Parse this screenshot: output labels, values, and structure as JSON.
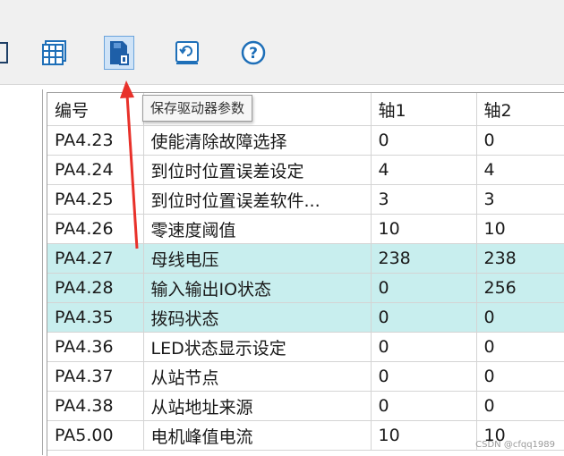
{
  "toolbar": {
    "buttons": [
      {
        "icon": "window-icon"
      },
      {
        "icon": "grid-table-icon"
      },
      {
        "icon": "save-drive-params-icon",
        "active": true
      },
      {
        "icon": "refresh-icon"
      },
      {
        "icon": "help-icon"
      }
    ],
    "tooltip": "保存驱动器参数"
  },
  "grid": {
    "headers": {
      "code": "编号",
      "name": "",
      "axis1": "轴1",
      "axis2": "轴2"
    },
    "rows": [
      {
        "code": "PA4.23",
        "name": "使能清除故障选择",
        "axis1": "0",
        "axis2": "0",
        "highlight": false
      },
      {
        "code": "PA4.24",
        "name": "到位时位置误差设定",
        "axis1": "4",
        "axis2": "4",
        "highlight": false
      },
      {
        "code": "PA4.25",
        "name": "到位时位置误差软件...",
        "axis1": "3",
        "axis2": "3",
        "highlight": false
      },
      {
        "code": "PA4.26",
        "name": "零速度阈值",
        "axis1": "10",
        "axis2": "10",
        "highlight": false
      },
      {
        "code": "PA4.27",
        "name": "母线电压",
        "axis1": "238",
        "axis2": "238",
        "highlight": true
      },
      {
        "code": "PA4.28",
        "name": "输入输出IO状态",
        "axis1": "0",
        "axis2": "256",
        "highlight": true
      },
      {
        "code": "PA4.35",
        "name": "拨码状态",
        "axis1": "0",
        "axis2": "0",
        "highlight": true
      },
      {
        "code": "PA4.36",
        "name": "LED状态显示设定",
        "axis1": "0",
        "axis2": "0",
        "highlight": false
      },
      {
        "code": "PA4.37",
        "name": "从站节点",
        "axis1": "0",
        "axis2": "0",
        "highlight": false
      },
      {
        "code": "PA4.38",
        "name": "从站地址来源",
        "axis1": "0",
        "axis2": "0",
        "highlight": false
      },
      {
        "code": "PA5.00",
        "name": "电机峰值电流",
        "axis1": "10",
        "axis2": "10",
        "highlight": false
      }
    ]
  },
  "colors": {
    "highlight_row": "#c8eeee",
    "arrow": "#e8312a",
    "icon_blue": "#1e6fb8"
  },
  "watermark": "CSDN @cfqq1989"
}
